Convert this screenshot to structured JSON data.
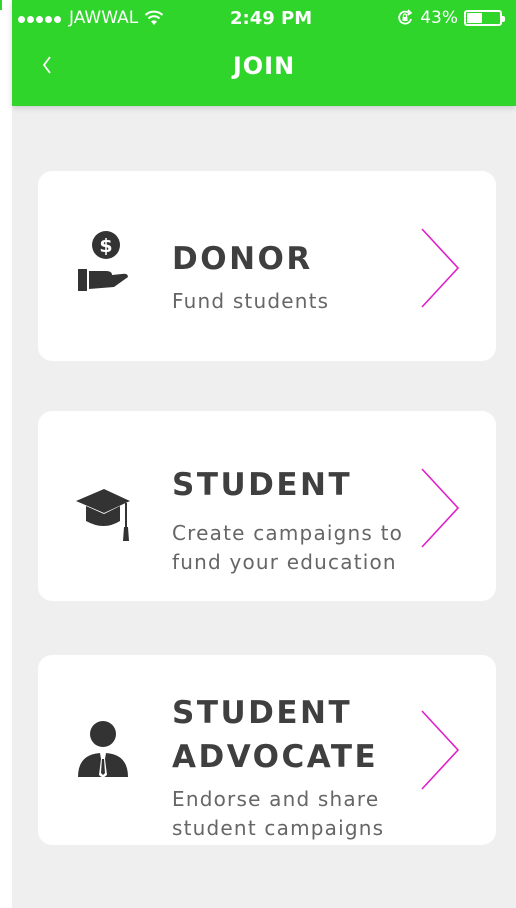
{
  "status_bar": {
    "carrier": "JAWWAL",
    "time": "2:49 PM",
    "battery": "43%",
    "battery_level": 0.43
  },
  "header": {
    "title": "JOIN",
    "back_icon": "chevron-left-icon",
    "color": "#2fd52a"
  },
  "options": [
    {
      "title": "DONOR",
      "description": [
        "Fund students"
      ],
      "icon": "donation-hand-icon"
    },
    {
      "title": "STUDENT",
      "description": [
        "Create campaigns to",
        "fund your education"
      ],
      "icon": "graduation-cap-icon"
    },
    {
      "title_lines": [
        "STUDENT",
        "ADVOCATE"
      ],
      "description": [
        "Endorse and share",
        "student campaigns"
      ],
      "icon": "person-tie-icon"
    }
  ],
  "colors": {
    "accent_chevron": "#e020c8",
    "background": "#efefef",
    "card": "#ffffff",
    "heading": "#3f3f3f"
  }
}
